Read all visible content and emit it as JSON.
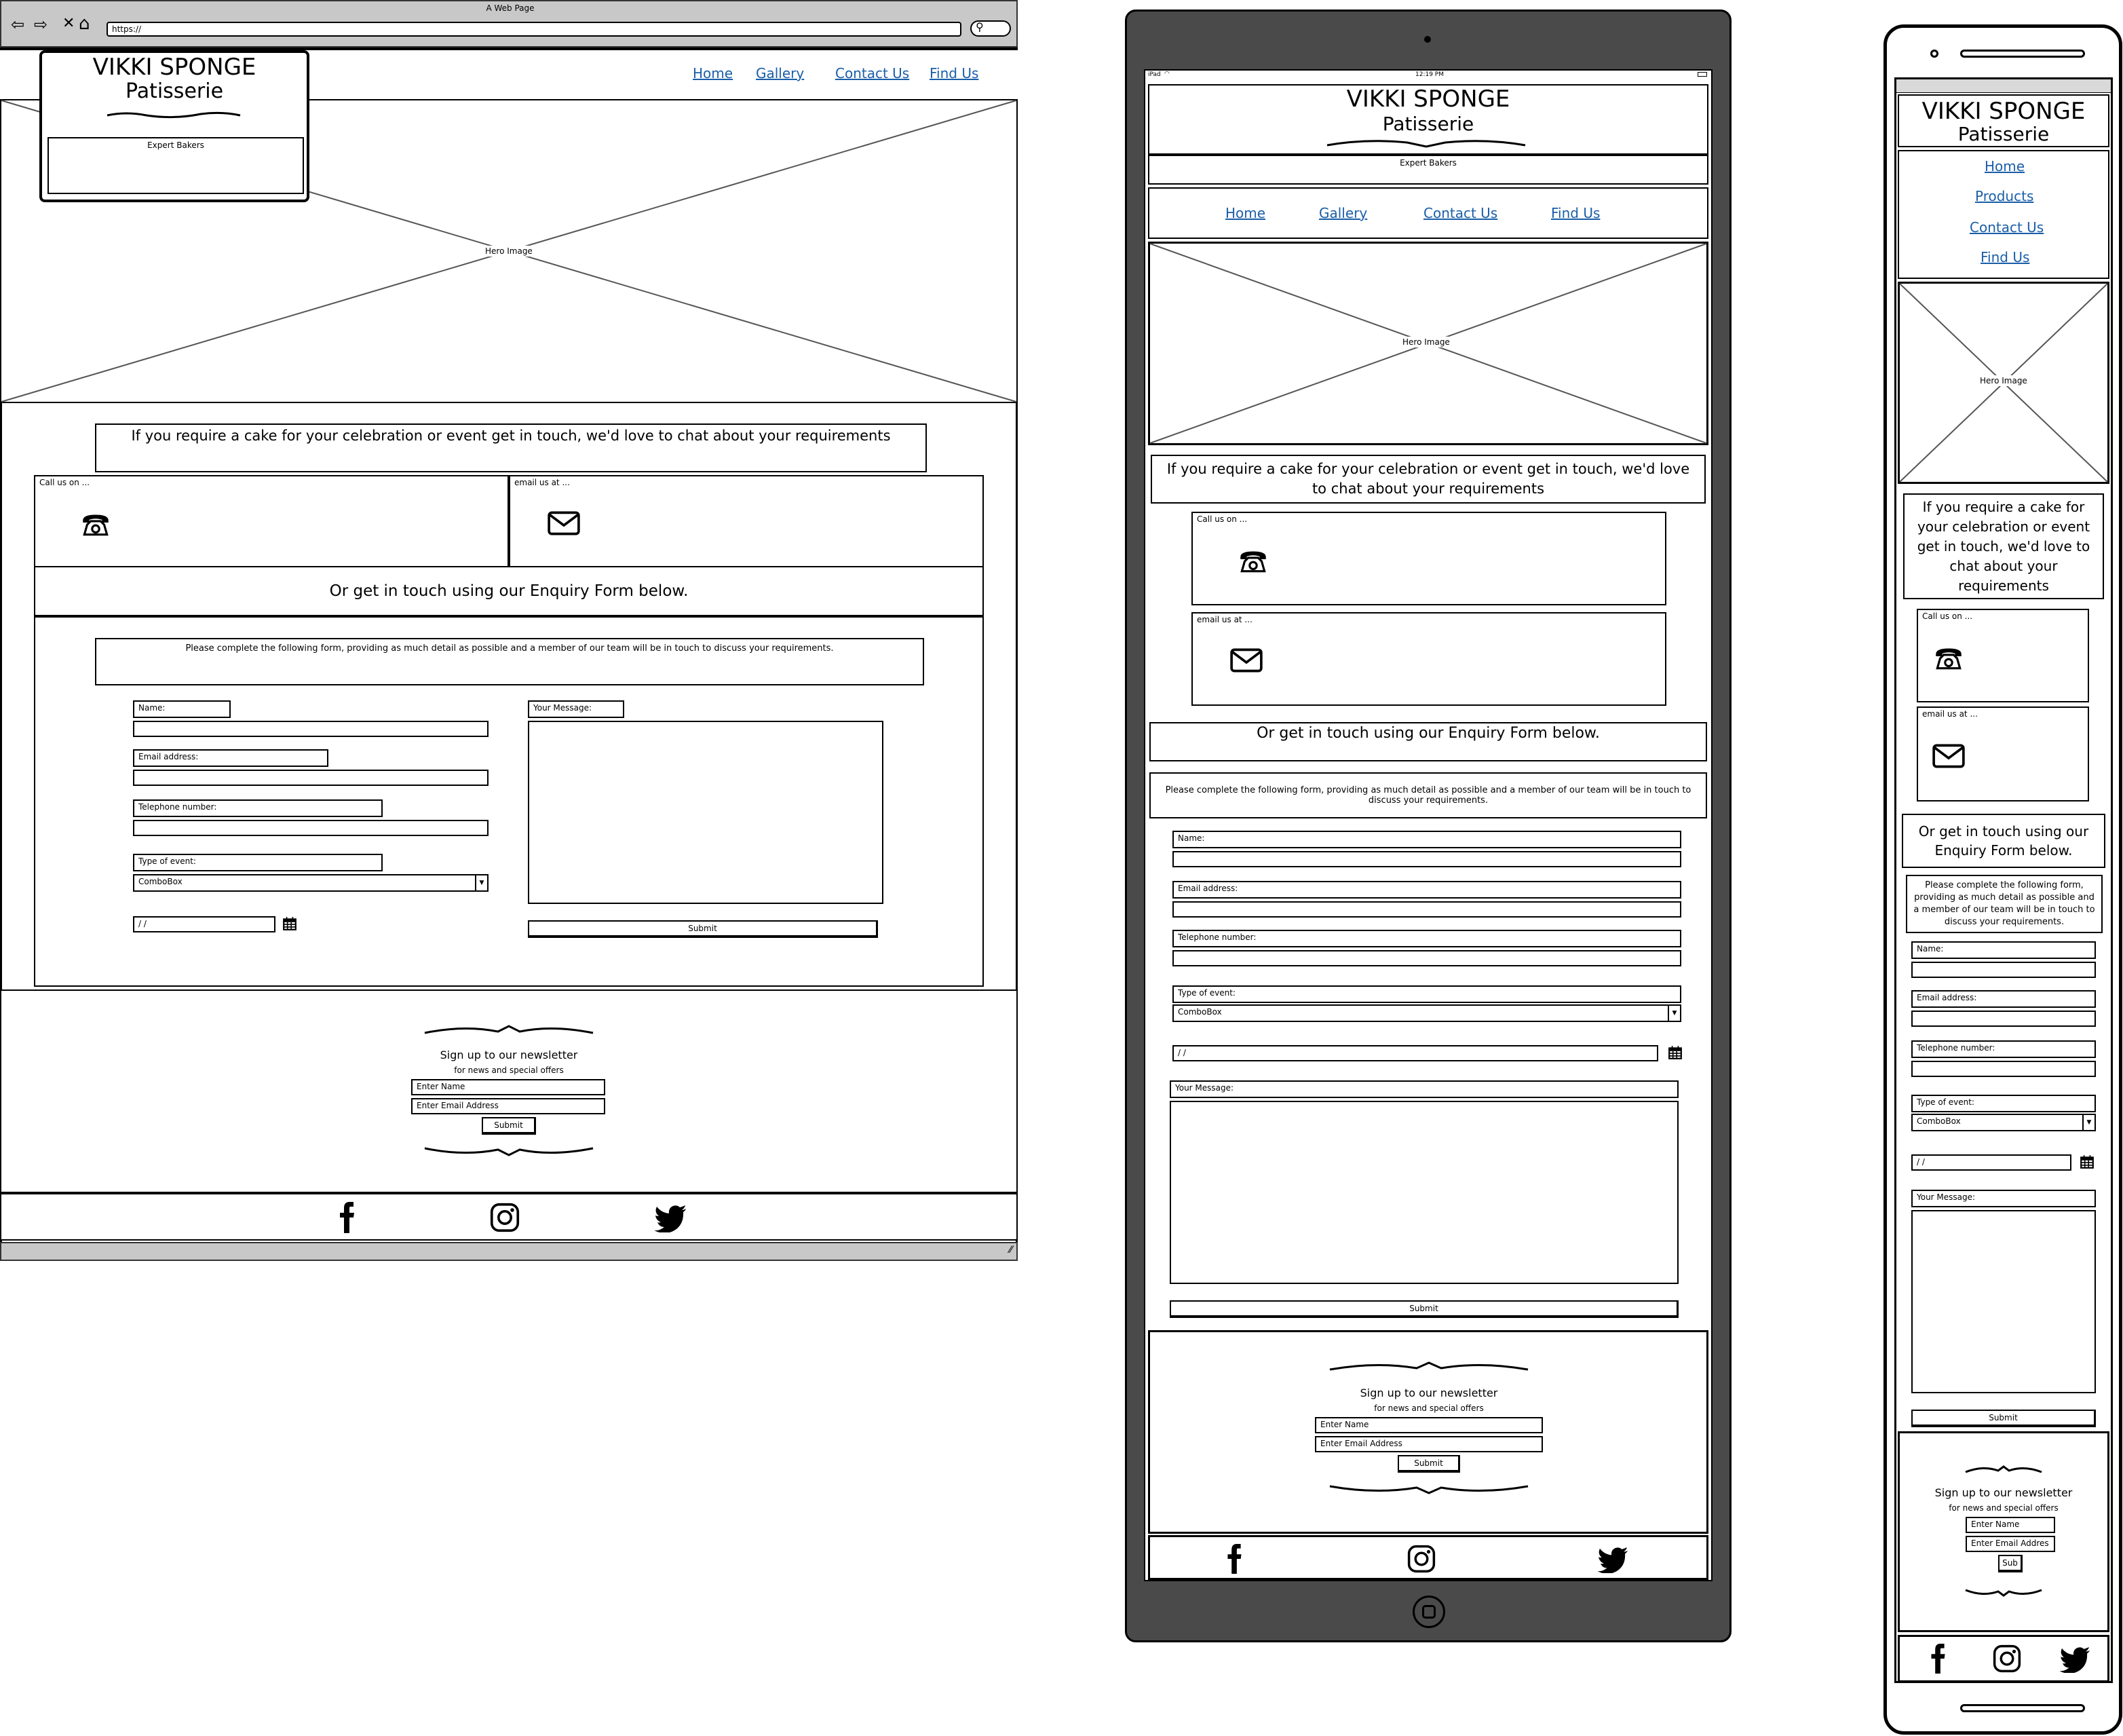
{
  "desktop": {
    "window_title": "A Web Page",
    "url": "https://",
    "brand": {
      "name": "VIKKI SPONGE",
      "sub": "Patisserie",
      "tagline": "Expert Bakers"
    },
    "nav": [
      {
        "label": "Home"
      },
      {
        "label": "Gallery"
      },
      {
        "label": "Contact Us"
      },
      {
        "label": "Find Us"
      }
    ],
    "hero": "Hero Image",
    "intro": "If you require a cake for your celebration or event get in touch, we'd love to chat about your requirements",
    "call_label": "Call us on ...",
    "email_label": "email us at ...",
    "or_text": "Or get in touch using our Enquiry Form below.",
    "form_intro": "Please complete the following form, providing as much detail as possible and a member of our team will be in touch to discuss your requirements.",
    "form": {
      "name": "Name:",
      "email": "Email address:",
      "phone": "Telephone number:",
      "event": "Type of event:",
      "combo": "ComboBox",
      "date": " /  /",
      "message": "Your Message:",
      "submit": "Submit"
    },
    "newsletter": {
      "title": "Sign up to our newsletter",
      "sub": "for news and special offers",
      "name_ph": "Enter Name",
      "email_ph": "Enter Email Address",
      "submit": "Submit"
    }
  },
  "tablet": {
    "status": {
      "left": "iPad",
      "time": "12:19 PM"
    },
    "brand": {
      "name": "VIKKI SPONGE",
      "sub": "Patisserie",
      "tagline": "Expert Bakers"
    },
    "nav": [
      {
        "label": "Home"
      },
      {
        "label": "Gallery"
      },
      {
        "label": "Contact Us"
      },
      {
        "label": "Find Us"
      }
    ],
    "hero": "Hero Image",
    "intro": "If you require a cake for your celebration or event get in touch, we'd love to chat about your requirements",
    "call_label": "Call us on ...",
    "email_label": "email us at ...",
    "or_text": "Or get in touch using our Enquiry Form below.",
    "form_intro": "Please complete the following form, providing as much detail as possible and a member of our team will be in touch to discuss your requirements.",
    "form": {
      "name": "Name:",
      "email": "Email address:",
      "phone": "Telephone number:",
      "event": "Type of event:",
      "combo": "ComboBox",
      "date": " /  /",
      "message": "Your Message:",
      "submit": "Submit"
    },
    "newsletter": {
      "title": "Sign up to our newsletter",
      "sub": "for news and special offers",
      "name_ph": "Enter Name",
      "email_ph": "Enter Email Address",
      "submit": "Submit"
    }
  },
  "phone": {
    "brand": {
      "name": "VIKKI SPONGE",
      "sub": "Patisserie"
    },
    "nav": [
      {
        "label": "Home"
      },
      {
        "label": "Products"
      },
      {
        "label": "Contact Us"
      },
      {
        "label": "Find Us"
      }
    ],
    "hero": "Hero Image",
    "intro": "If you require a cake for your celebration or event get in touch, we'd love to chat about your requirements",
    "call_label": "Call us on ...",
    "email_label": "email us at ...",
    "or_text": "Or get in touch using our Enquiry Form below.",
    "form_intro": "Please complete the following form, providing as much detail as possible and a member of our team will be in touch to discuss your requirements.",
    "form": {
      "name": "Name:",
      "email": "Email address:",
      "phone": "Telephone number:",
      "event": "Type of event:",
      "combo": "ComboBox",
      "date": " /  /",
      "message": "Your Message:",
      "submit": "Submit"
    },
    "newsletter": {
      "title": "Sign up to our newsletter",
      "sub": "for news and special offers",
      "name_ph": "Enter Name",
      "email_ph": "Enter Email Addres",
      "submit": "Sub"
    }
  },
  "colors": {
    "link": "#1a5ea8",
    "tablet_frame": "#4a4a4a",
    "chrome": "#c8c8c8"
  },
  "icons": [
    "back-arrow-icon",
    "forward-arrow-icon",
    "stop-icon",
    "home-icon",
    "search-icon",
    "phone-icon",
    "envelope-icon",
    "calendar-icon",
    "facebook-icon",
    "instagram-icon",
    "twitter-icon",
    "camera-icon",
    "home-button-icon",
    "wifi-icon",
    "battery-icon"
  ]
}
